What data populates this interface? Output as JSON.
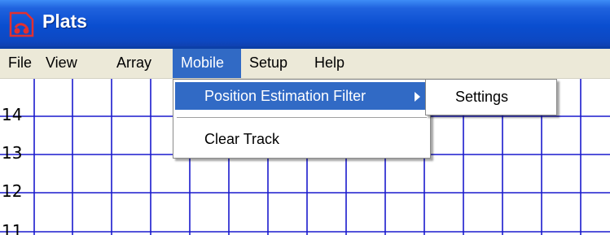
{
  "window": {
    "title": "Plats",
    "icon": "plats-app-icon"
  },
  "menubar": {
    "items": [
      "File",
      "View",
      "Array",
      "Mobile",
      "Setup",
      "Help"
    ],
    "active": "Mobile"
  },
  "mobile_menu": {
    "items": [
      {
        "label": "Position Estimation Filter",
        "has_submenu": true,
        "highlighted": true
      },
      {
        "label": "Clear Track",
        "has_submenu": false,
        "highlighted": false
      }
    ]
  },
  "submenu": {
    "items": [
      "Settings"
    ]
  },
  "plot": {
    "y_tick_labels": [
      "14",
      "13",
      "12",
      "11"
    ],
    "grid_color": "#1a1acd"
  },
  "colors": {
    "title_bar": "#0a4ed0",
    "menu_highlight": "#316ac5",
    "menubar_bg": "#ece9d8"
  }
}
